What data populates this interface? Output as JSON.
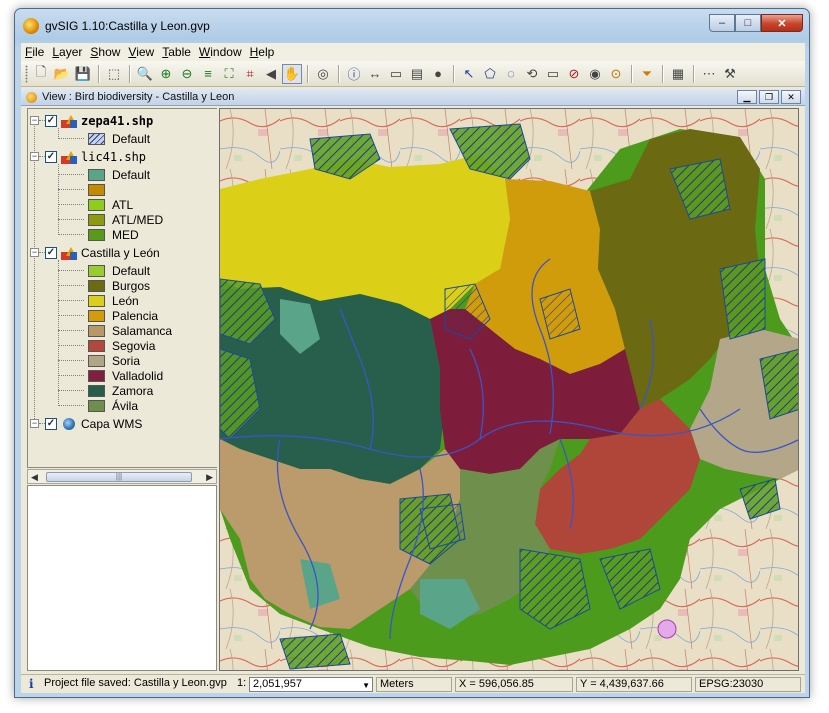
{
  "window": {
    "title": "gvSIG 1.10:Castilla y Leon.gvp",
    "minimize": "–",
    "maximize": "□",
    "close": "✕"
  },
  "menus": [
    {
      "label": "File",
      "u": "F",
      "rest": "ile"
    },
    {
      "label": "Layer",
      "u": "L",
      "rest": "ayer"
    },
    {
      "label": "Show",
      "u": "S",
      "rest": "how"
    },
    {
      "label": "View",
      "u": "V",
      "rest": "iew"
    },
    {
      "label": "Table",
      "u": "T",
      "rest": "able"
    },
    {
      "label": "Window",
      "u": "W",
      "rest": "indow"
    },
    {
      "label": "Help",
      "u": "H",
      "rest": "elp"
    }
  ],
  "toolbar_icons": [
    "new-icon",
    "open-icon",
    "save-icon",
    "|",
    "import-icon",
    "|",
    "zoom-in-icon",
    "zoom-plus-icon",
    "zoom-minus-icon",
    "layers-zoom-icon",
    "zoom-extent-icon",
    "zoom-select-icon",
    "previous-zoom-icon",
    "pan-icon",
    "|",
    "locator-icon",
    "|",
    "info-icon",
    "measure-distance-icon",
    "measure-area-icon",
    "chart-icon",
    "hyperlink-icon",
    "|",
    "select-icon",
    "select-polygon-icon",
    "select-circle-icon",
    "select-invert-icon",
    "select-rectangle-icon",
    "clear-selection-icon",
    "select-by-point-icon",
    "select-target-icon",
    "|",
    "filter-icon",
    "|",
    "table-icon",
    "|",
    "grid-icon",
    "tools-icon"
  ],
  "view": {
    "title": "View : Bird biodiversity - Castilla y Leon"
  },
  "toc": {
    "layers": [
      {
        "name": "zepa41.shp",
        "bold": true,
        "checked": true,
        "legend": [
          {
            "label": "Default",
            "color": "#c9d2ec",
            "hatched": true
          }
        ]
      },
      {
        "name": "lic41.shp",
        "bold": false,
        "checked": true,
        "legend": [
          {
            "label": "Default",
            "color": "#5aa58a"
          },
          {
            "label": "",
            "color": "#c48a00"
          },
          {
            "label": "ATL",
            "color": "#8fcc1e"
          },
          {
            "label": "ATL/MED",
            "color": "#8c9a10"
          },
          {
            "label": "MED",
            "color": "#5a9a1a"
          }
        ]
      },
      {
        "name": "Castilla y León",
        "bold": false,
        "checked": true,
        "legend": [
          {
            "label": "Default",
            "color": "#99cc33"
          },
          {
            "label": "Burgos",
            "color": "#6b6b12"
          },
          {
            "label": "León",
            "color": "#d9cf1c"
          },
          {
            "label": "Palencia",
            "color": "#d39d0a"
          },
          {
            "label": "Salamanca",
            "color": "#b99868"
          },
          {
            "label": "Segovia",
            "color": "#b4463a"
          },
          {
            "label": "Soria",
            "color": "#b2a586"
          },
          {
            "label": "Valladolid",
            "color": "#821f3e"
          },
          {
            "label": "Zamora",
            "color": "#275e4b"
          },
          {
            "label": "Ávila",
            "color": "#6e8e4c"
          }
        ]
      },
      {
        "name": "Capa WMS",
        "bold": false,
        "checked": true,
        "legend": []
      }
    ],
    "scroll_thumb": "|||"
  },
  "status": {
    "message": "Project file saved: Castilla y Leon.gvp",
    "scale_prefix": "1:",
    "scale": "2,051,957",
    "units": "Meters",
    "x": "X = 596,056.85",
    "y": "Y = 4,439,637.66",
    "epsg": "EPSG:23030"
  },
  "colors": {
    "leon": "#dccf18",
    "palencia": "#d19c0b",
    "burgos": "#6b6a12",
    "zamora": "#275f4c",
    "valladolid": "#7e1c3c",
    "segovia": "#b0453a",
    "soria": "#b4a789",
    "salamanca": "#bb9a6c",
    "avila": "#6f904c",
    "lic_green": "#4f9a1a",
    "river": "#3a55c6"
  }
}
